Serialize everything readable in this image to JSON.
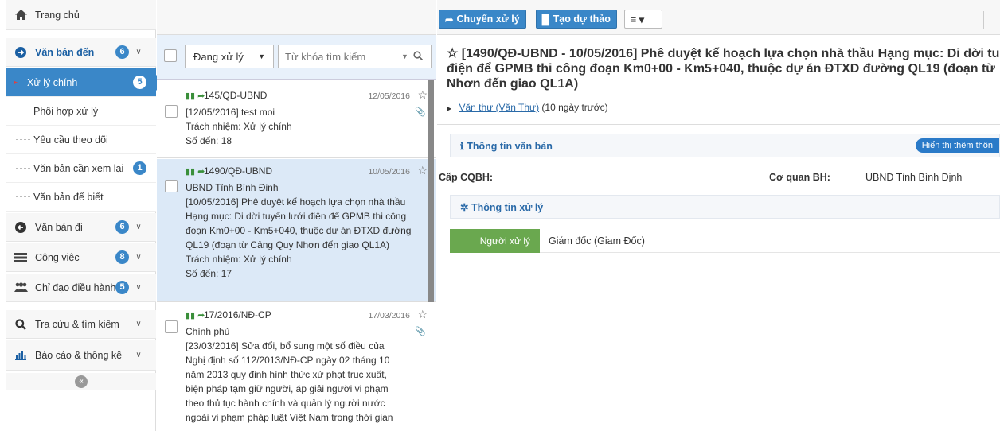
{
  "sidebar": {
    "home": "Trang chủ",
    "incoming": {
      "label": "Văn bản đến",
      "count": "6"
    },
    "sub_items": [
      {
        "label": "Xử lý chính",
        "count": "5"
      },
      {
        "label": "Phối hợp xử lý",
        "count": ""
      },
      {
        "label": "Yêu cầu theo dõi",
        "count": ""
      },
      {
        "label": "Văn bản cần xem lại",
        "count": "1"
      },
      {
        "label": "Văn bản để biết",
        "count": ""
      }
    ],
    "outgoing": {
      "label": "Văn bản đi",
      "count": "6"
    },
    "tasks": {
      "label": "Công việc",
      "count": "8"
    },
    "directives": {
      "label": "Chỉ đạo điều hành",
      "count": "5"
    },
    "search": {
      "label": "Tra cứu & tìm kiếm"
    },
    "reports": {
      "label": "Báo cáo & thống kê"
    }
  },
  "list": {
    "filter_status": "Đang xử lý",
    "search_placeholder": "Từ khóa tìm kiếm",
    "items": [
      {
        "number": "145/QĐ-UBND",
        "date": "12/05/2016",
        "lines": [
          "[12/05/2016] test moi",
          "Trách nhiệm: Xử lý chính",
          "Số đến: 18"
        ]
      },
      {
        "number": "1490/QĐ-UBND",
        "date": "10/05/2016",
        "lines": [
          "UBND Tỉnh Bình Định",
          "[10/05/2016] Phê duyệt kế hoạch lựa chọn nhà thầu",
          "Hạng mục: Di dời tuyến lưới điện để GPMB thi công",
          "đoạn Km0+00 - Km5+040, thuộc dự án ĐTXD đường",
          "QL19 (đoạn từ Cảng Quy Nhơn đến giao QL1A)",
          "Trách nhiệm: Xử lý chính",
          "Số đến: 17"
        ]
      },
      {
        "number": "17/2016/NĐ-CP",
        "date": "17/03/2016",
        "lines": [
          "Chính phủ",
          "[23/03/2016] Sửa đổi, bổ sung một số điều của",
          "Nghị định số 112/2013/NĐ-CP ngày 02 tháng 10",
          "năm 2013 quy định hình thức xử phạt trục xuất,",
          "biện pháp tạm giữ người, áp giải người vi phạm",
          "theo thủ tục hành chính và quản lý người nước",
          "ngoài vi phạm pháp luật Việt Nam trong thời gian"
        ]
      }
    ]
  },
  "toolbar": {
    "forward": "Chuyển xử lý",
    "draft": "Tạo dự thảo"
  },
  "detail": {
    "title_lines": [
      "☆ [1490/QĐ-UBND - 10/05/2016] Phê duyệt kế hoạch lựa chọn nhà thầu Hạng mục: Di dời tu",
      "điện để GPMB thi công đoạn Km0+00 - Km5+040, thuộc dự án ĐTXD đường QL19 (đoạn từ",
      "Nhơn đến giao QL1A)"
    ],
    "sender_link": "Văn thư (Văn Thư)",
    "sender_time": "(10 ngày trước)",
    "doc_info_title": "Thông tin văn bản",
    "more_button": "Hiển thị thêm thôn",
    "issuer_level_label": "Cấp CQBH:",
    "issuer_level_value": "",
    "issuer_label": "Cơ quan BH:",
    "issuer_value": "UBND Tỉnh Bình Định",
    "processing_title": "Thông tin xử lý",
    "handler_label": "Người xử lý",
    "handler_value": "Giám đốc (Giam Đốc)"
  }
}
